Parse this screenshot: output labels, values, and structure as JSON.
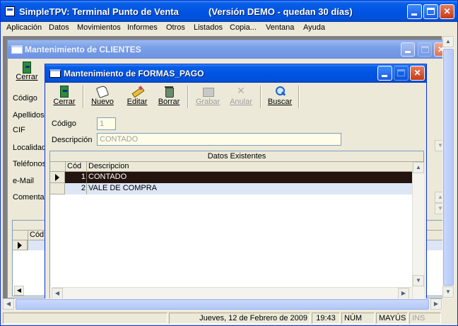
{
  "app": {
    "title": "SimpleTPV: Terminal Punto de Venta",
    "version": "(Versión DEMO - quedan 30 días)"
  },
  "menu": [
    "Aplicación",
    "Datos",
    "Movimientos",
    "Informes",
    "Otros",
    "Listados",
    "Copia...",
    "Ventana",
    "Ayuda"
  ],
  "clients_window": {
    "title": "Mantenimiento de CLIENTES",
    "cerrar_label": "Cerrar",
    "field_labels": [
      "Código",
      "Apellidos",
      "CIF",
      "Localidad",
      "Teléfonos",
      "e-Mail",
      "Comentar"
    ],
    "grid_header_fragment": "Cód"
  },
  "formas_pago_window": {
    "title": "Mantenimiento de FORMAS_PAGO",
    "toolbar": {
      "cerrar": "Cerrar",
      "nuevo": "Nuevo",
      "editar": "Editar",
      "borrar": "Borrar",
      "grabar": "Grabar",
      "anular": "Anular",
      "buscar": "Buscar"
    },
    "fields": {
      "codigo_label": "Código",
      "codigo_value": "1",
      "descripcion_label": "Descripción",
      "descripcion_value": "CONTADO"
    },
    "grid": {
      "caption": "Datos Existentes",
      "columns": [
        "Cód",
        "Descripcion"
      ],
      "rows": [
        {
          "cod": "1",
          "descripcion": "CONTADO"
        },
        {
          "cod": "2",
          "descripcion": "VALE DE COMPRA"
        }
      ]
    }
  },
  "status_bar": {
    "date": "Jueves, 12 de Febrero de 2009",
    "time": "19:43",
    "num": "NÚM",
    "mayus": "MAYÚS",
    "ins": "INS"
  },
  "icons": {
    "cerrar": "exit-door-icon",
    "nuevo": "new-document-icon",
    "editar": "pencil-icon",
    "borrar": "trash-icon",
    "grabar": "save-icon",
    "anular": "cancel-x-icon",
    "buscar": "magnifier-icon"
  },
  "colors": {
    "title_bar": "#0054e3",
    "selected_row": "#24140f",
    "row_background": "#dde6f5",
    "readonly_field": "#fffde7"
  }
}
